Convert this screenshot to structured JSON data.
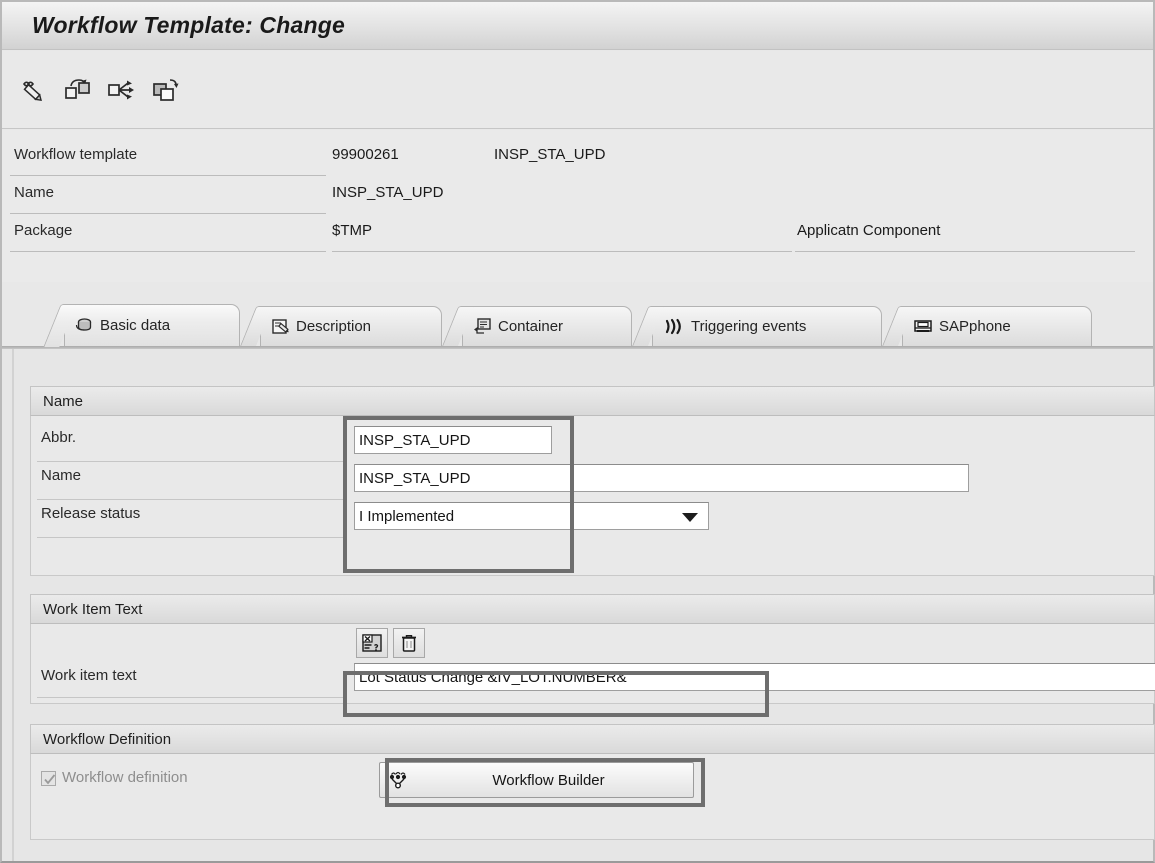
{
  "window": {
    "title": "Workflow Template: Change"
  },
  "toolbar": {
    "buttons": [
      {
        "name": "display-change-icon",
        "tooltip": "Display <-> Change"
      },
      {
        "name": "workflow-steps-icon",
        "tooltip": "Workflow steps"
      },
      {
        "name": "event-linkage-icon",
        "tooltip": "Event linkage"
      },
      {
        "name": "copy-version-icon",
        "tooltip": "Copy version"
      }
    ]
  },
  "header": {
    "rows": [
      {
        "label": "Workflow template",
        "value": "99900261",
        "value2": "INSP_STA_UPD"
      },
      {
        "label": "Name",
        "value": "INSP_STA_UPD",
        "value2": ""
      },
      {
        "label": "Package",
        "value": "$TMP",
        "value2": ""
      }
    ],
    "applicatn_component_label": "Applicatn Component"
  },
  "tabs": [
    {
      "label": "Basic data",
      "icon": "basic-data-icon",
      "active": true
    },
    {
      "label": "Description",
      "icon": "description-icon",
      "active": false
    },
    {
      "label": "Container",
      "icon": "container-icon",
      "active": false
    },
    {
      "label": "Triggering events",
      "icon": "triggering-events-icon",
      "active": false
    },
    {
      "label": "SAPphone",
      "icon": "sapphone-icon",
      "active": false
    }
  ],
  "groups": {
    "name": {
      "title": "Name",
      "fields": [
        {
          "label": "Abbr.",
          "value": "INSP_STA_UPD"
        },
        {
          "label": "Name",
          "value": "INSP_STA_UPD"
        },
        {
          "label": "Release status",
          "value": "I Implemented"
        }
      ]
    },
    "work_item_text": {
      "title": "Work Item Text",
      "toolbar": [
        {
          "name": "expression-icon"
        },
        {
          "name": "trash-icon"
        }
      ],
      "field": {
        "label": "Work item text",
        "value": "Lot Status Change &IV_LOT.NUMBER&"
      }
    },
    "workflow_definition": {
      "title": "Workflow Definition",
      "checkbox": {
        "label": "Workflow definition",
        "checked": true,
        "disabled": true
      },
      "button": {
        "label": "Workflow Builder",
        "icon": "workflow-builder-icon"
      }
    }
  },
  "colors": {
    "highlight": "#6e6e6e",
    "panel_bg": "#e6e6e6",
    "title_text": "#1a1a1a",
    "field_text": "#151515",
    "disabled_text": "#8e8e8e"
  }
}
